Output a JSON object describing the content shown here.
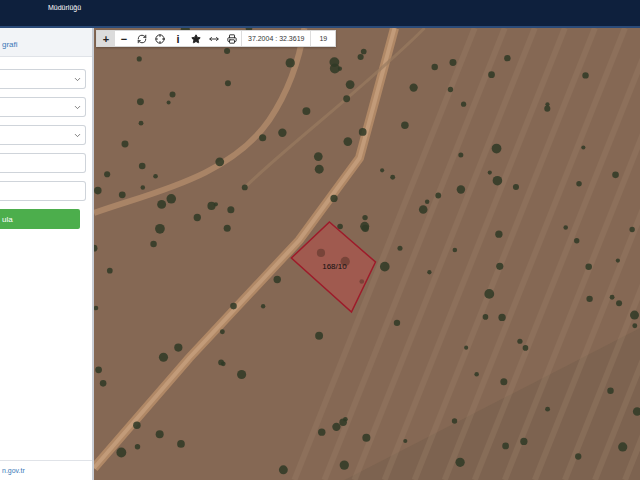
{
  "header": {
    "title": "Müdürlüğü"
  },
  "sidebar": {
    "title": "grafi",
    "fields": [
      {
        "kind": "select"
      },
      {
        "kind": "select"
      },
      {
        "kind": "select"
      },
      {
        "kind": "input"
      },
      {
        "kind": "input"
      }
    ],
    "button": "ula",
    "footer": "n.gov.tr"
  },
  "toolbar": {
    "tools": [
      {
        "kind": "glyph",
        "label": "+",
        "selected": true
      },
      {
        "kind": "glyph",
        "label": "−",
        "selected": false
      },
      {
        "kind": "refresh",
        "selected": false
      },
      {
        "kind": "locate",
        "selected": false
      },
      {
        "kind": "glyph",
        "label": "i",
        "selected": false
      },
      {
        "kind": "star",
        "selected": false
      },
      {
        "kind": "measure",
        "selected": false
      },
      {
        "kind": "print",
        "selected": false
      }
    ],
    "coordinates": "37.2004 : 32.3619",
    "zoom": "19"
  },
  "parcel": {
    "label": "168/10"
  }
}
